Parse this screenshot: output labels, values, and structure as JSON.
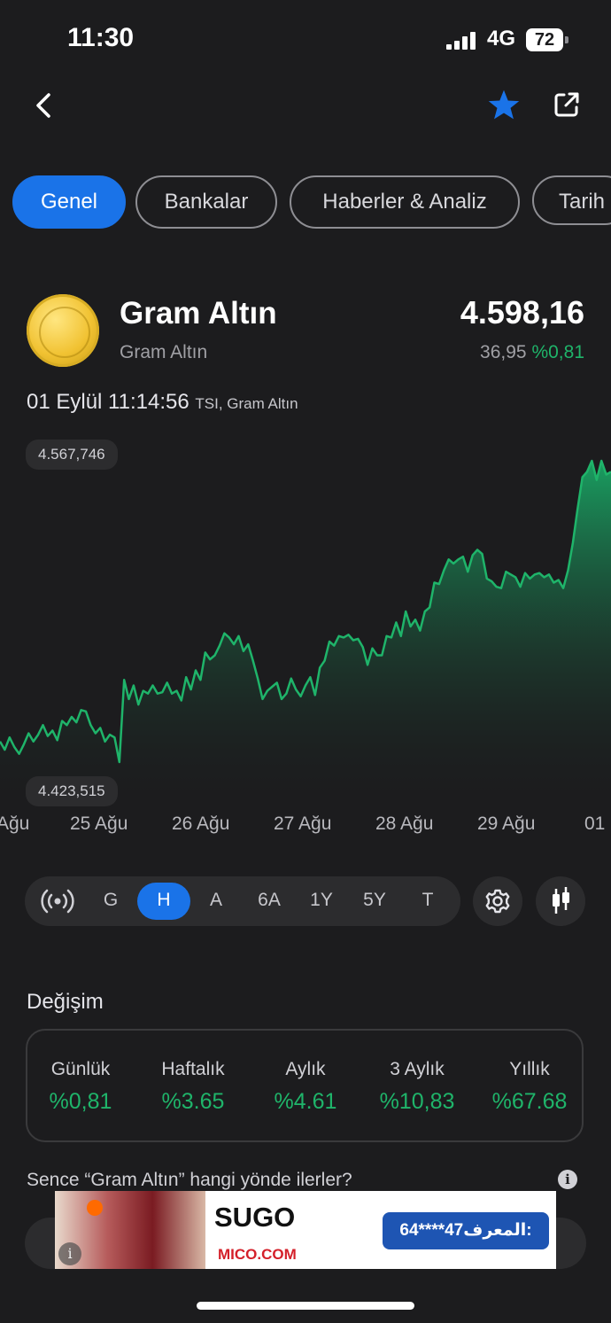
{
  "status": {
    "time": "11:30",
    "network": "4G",
    "battery": "72"
  },
  "header": {
    "back_icon": "chevron-left-icon",
    "favorite_icon": "star-icon",
    "share_icon": "external-link-icon",
    "accent": "#1a73e8"
  },
  "tabs": [
    {
      "label": "Genel",
      "active": true
    },
    {
      "label": "Bankalar"
    },
    {
      "label": "Haberler & Analiz"
    },
    {
      "label": "Tarih"
    }
  ],
  "instrument": {
    "title": "Gram Altın",
    "subtitle": "Gram Altın",
    "price": "4.598,16",
    "change_abs": "36,95",
    "change_pct": "%0,81",
    "timestamp": "01 Eylül 11:14:56",
    "timestamp_suffix": "TSI, Gram Altın"
  },
  "chart_data": {
    "type": "area",
    "max_label": "4.567,746",
    "min_label": "4.423,515",
    "x_ticks": [
      "Ağu",
      "25 Ağu",
      "26 Ağu",
      "27 Ağu",
      "28 Ağu",
      "29 Ağu",
      "01"
    ],
    "color": "#1fb46a",
    "series": [
      {
        "values": [
          4435,
          4429,
          4438,
          4431,
          4426,
          4433,
          4441,
          4435,
          4440,
          4447,
          4439,
          4443,
          4436,
          4450,
          4447,
          4453,
          4449,
          4458,
          4457,
          4447,
          4441,
          4445,
          4435,
          4440,
          4438,
          4420,
          4480,
          4466,
          4476,
          4462,
          4472,
          4470,
          4476,
          4470,
          4471,
          4478,
          4470,
          4472,
          4465,
          4482,
          4473,
          4487,
          4480,
          4500,
          4495,
          4498,
          4505,
          4514,
          4511,
          4506,
          4512,
          4501,
          4506,
          4494,
          4481,
          4466,
          4472,
          4475,
          4478,
          4466,
          4470,
          4481,
          4473,
          4468,
          4476,
          4482,
          4469,
          4489,
          4494,
          4508,
          4505,
          4512,
          4511,
          4513,
          4509,
          4510,
          4504,
          4491,
          4503,
          4498,
          4498,
          4512,
          4511,
          4522,
          4512,
          4530,
          4519,
          4524,
          4516,
          4530,
          4533,
          4551,
          4550,
          4560,
          4568,
          4565,
          4568,
          4570,
          4559,
          4571,
          4575,
          4572,
          4554,
          4552,
          4548,
          4547,
          4559,
          4557,
          4555,
          4548,
          4558,
          4554,
          4557,
          4558,
          4555,
          4557,
          4551,
          4553,
          4547,
          4560,
          4580,
          4605,
          4628,
          4632,
          4640,
          4626,
          4640,
          4630,
          4632
        ]
      }
    ]
  },
  "ranges": [
    "G",
    "H",
    "A",
    "6A",
    "1Y",
    "5Y",
    "T"
  ],
  "range_active": "H",
  "range_icons": {
    "live": "live-broadcast-icon",
    "settings": "gear-icon",
    "chart_type": "candlestick-icon"
  },
  "changes": {
    "title": "Değişim",
    "items": [
      {
        "period": "Günlük",
        "value": "%0,81"
      },
      {
        "period": "Haftalık",
        "value": "%3.65"
      },
      {
        "period": "Aylık",
        "value": "%4.61"
      },
      {
        "period": "3 Aylık",
        "value": "%10,83"
      },
      {
        "period": "Yıllık",
        "value": "%67.68"
      }
    ]
  },
  "poll": {
    "question": "Sence “Gram Altın” hangi yönde ilerler?",
    "info_icon": "info-icon"
  },
  "ad": {
    "brand": "SUGO",
    "domain": "MICO.COM",
    "button": "64****47المعرف:",
    "info_icon": "info-icon"
  }
}
